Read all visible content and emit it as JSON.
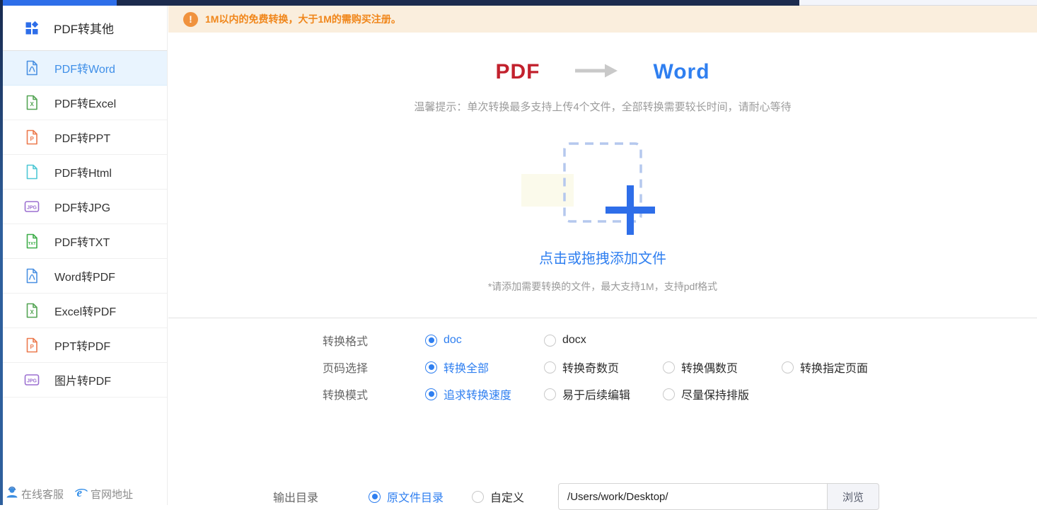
{
  "theme": {
    "topbar_accent": "#2e6ee9",
    "topbar_dark": "#1c2b4e",
    "side_strip_blue": "#2e5f9c",
    "accent_blue": "#2f7ff0",
    "selected_item_bg": "#e9f4fe",
    "banner_bg": "#faeedd",
    "banner_orange": "#f0861a",
    "pdf_red": "#c2212d",
    "word_blue": "#2f7ff0"
  },
  "sidebar": {
    "header": {
      "label": "PDF转其他",
      "icon": "grid-icon",
      "icon_color": "#2e6ee9"
    },
    "items": [
      {
        "label": "PDF转Word",
        "icon": "pdf-doc-icon",
        "icon_color": "#4a90e2",
        "glyph": "",
        "selected": true
      },
      {
        "label": "PDF转Excel",
        "icon": "excel-doc-icon",
        "icon_color": "#55a555",
        "glyph": "X",
        "selected": false
      },
      {
        "label": "PDF转PPT",
        "icon": "ppt-doc-icon",
        "icon_color": "#ec7a4e",
        "glyph": "P",
        "selected": false
      },
      {
        "label": "PDF转Html",
        "icon": "html-doc-icon",
        "icon_color": "#4fc8d5",
        "glyph": "</>",
        "selected": false
      },
      {
        "label": "PDF转JPG",
        "icon": "jpg-badge-icon",
        "icon_color": "#9b6fd0",
        "glyph": "JPG",
        "selected": false
      },
      {
        "label": "PDF转TXT",
        "icon": "txt-doc-icon",
        "icon_color": "#3fae4a",
        "glyph": "TXT",
        "selected": false
      },
      {
        "label": "Word转PDF",
        "icon": "pdf-doc-icon",
        "icon_color": "#4a90e2",
        "glyph": "",
        "selected": false
      },
      {
        "label": "Excel转PDF",
        "icon": "excel-doc-icon",
        "icon_color": "#55a555",
        "glyph": "X",
        "selected": false
      },
      {
        "label": "PPT转PDF",
        "icon": "ppt-doc-icon",
        "icon_color": "#ec7a4e",
        "glyph": "P",
        "selected": false
      },
      {
        "label": "图片转PDF",
        "icon": "jpg-badge-icon",
        "icon_color": "#9b6fd0",
        "glyph": "JPG",
        "selected": false
      }
    ],
    "footer": [
      {
        "label": "在线客服",
        "icon": "support-agent-icon"
      },
      {
        "label": "官网地址",
        "icon": "ie-globe-icon"
      }
    ]
  },
  "banner": {
    "icon": "alert-icon",
    "icon_glyph": "!",
    "text": "1M以内的免费转换，大于1M的需购买注册。"
  },
  "main": {
    "title": {
      "source": "PDF",
      "target": "Word"
    },
    "tip": "温馨提示：单次转换最多支持上传4个文件，全部转换需要较长时间，请耐心等待",
    "upload": {
      "cta": "点击或拖拽添加文件",
      "note": "*请添加需要转换的文件，最大支持1M，支持pdf格式"
    },
    "options": [
      {
        "label": "转换格式",
        "choices": [
          {
            "text": "doc",
            "selected": true
          },
          {
            "text": "docx",
            "selected": false
          }
        ]
      },
      {
        "label": "页码选择",
        "choices": [
          {
            "text": "转换全部",
            "selected": true
          },
          {
            "text": "转换奇数页",
            "selected": false
          },
          {
            "text": "转换偶数页",
            "selected": false
          },
          {
            "text": "转换指定页面",
            "selected": false
          }
        ]
      },
      {
        "label": "转换模式",
        "choices": [
          {
            "text": "追求转换速度",
            "selected": true
          },
          {
            "text": "易于后续编辑",
            "selected": false
          },
          {
            "text": "尽量保持排版",
            "selected": false
          }
        ]
      }
    ],
    "output": {
      "label": "输出目录",
      "choices": [
        {
          "text": "原文件目录",
          "selected": true
        },
        {
          "text": "自定义",
          "selected": false
        }
      ],
      "path_value": "/Users/work/Desktop/",
      "browse_label": "浏览"
    }
  }
}
